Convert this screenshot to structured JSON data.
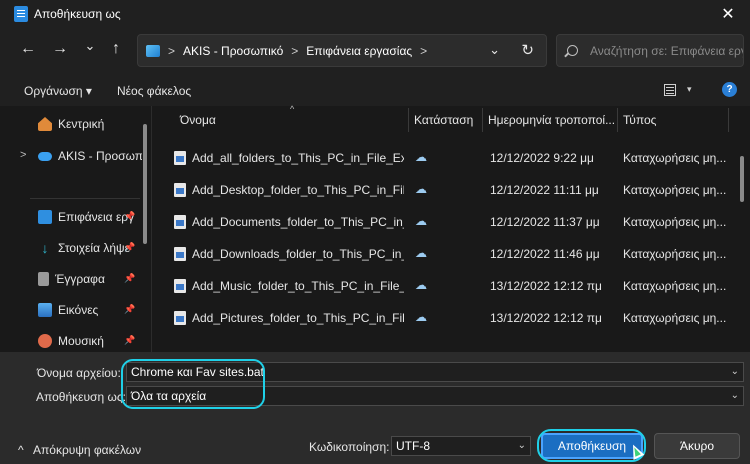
{
  "window": {
    "title": "Αποθήκευση ως",
    "close_glyph": "✕"
  },
  "nav": {
    "back_glyph": "←",
    "forward_glyph": "→",
    "recent_glyph": "⌄",
    "up_glyph": "↑",
    "breadcrumbs": [
      "AKIS - Προσωπικό",
      "Επιφάνεια εργασίας"
    ],
    "crumb_sep": ">",
    "dropdown_glyph": "⌄",
    "refresh_glyph": "↻",
    "search_placeholder": "Αναζήτηση σε: Επιφάνεια εργ"
  },
  "toolbar": {
    "organize_label": "Οργάνωση ▾",
    "new_folder_label": "Νέος φάκελος",
    "view_dd_glyph": "▾",
    "help_glyph": "?"
  },
  "sidebar": {
    "home_label": "Κεντρική",
    "cloud_label": "AKIS - Προσωπικό",
    "chevron_glyph": ">",
    "pin_glyph": "📌",
    "quick": [
      {
        "label": "Επιφάνεια εργ",
        "icon": "desktop-icon",
        "color": "#2f8fe0"
      },
      {
        "label": "Στοιχεία λήψε",
        "icon": "download-icon",
        "color": "#2fb2c8"
      },
      {
        "label": "Έγγραφα",
        "icon": "documents-icon",
        "color": "#9a9a9a"
      },
      {
        "label": "Εικόνες",
        "icon": "pictures-icon",
        "color": "#3a8fd8"
      },
      {
        "label": "Μουσική",
        "icon": "music-icon",
        "color": "#e06a4a"
      }
    ]
  },
  "columns": {
    "name": "Όνομα",
    "status": "Κατάσταση",
    "date": "Ημερομηνία τροποποί...",
    "type": "Τύπος",
    "sort_glyph": "^"
  },
  "files": [
    {
      "name": "Add_all_folders_to_This_PC_in_File_Explor...",
      "status_glyph": "☁",
      "date": "12/12/2022 9:22 μμ",
      "type": "Καταχωρήσεις μη..."
    },
    {
      "name": "Add_Desktop_folder_to_This_PC_in_File_E...",
      "status_glyph": "☁",
      "date": "12/12/2022 11:11 μμ",
      "type": "Καταχωρήσεις μη..."
    },
    {
      "name": "Add_Documents_folder_to_This_PC_in_Fil...",
      "status_glyph": "☁",
      "date": "12/12/2022 11:37 μμ",
      "type": "Καταχωρήσεις μη..."
    },
    {
      "name": "Add_Downloads_folder_to_This_PC_in_Fil...",
      "status_glyph": "☁",
      "date": "12/12/2022 11:46 μμ",
      "type": "Καταχωρήσεις μη..."
    },
    {
      "name": "Add_Music_folder_to_This_PC_in_File_Exp...",
      "status_glyph": "☁",
      "date": "13/12/2022 12:12 πμ",
      "type": "Καταχωρήσεις μη..."
    },
    {
      "name": "Add_Pictures_folder_to_This_PC_in_File_E...",
      "status_glyph": "☁",
      "date": "13/12/2022 12:12 πμ",
      "type": "Καταχωρήσεις μη..."
    }
  ],
  "form": {
    "filename_label": "Όνομα αρχείου:",
    "filename_value": "Chrome και Fav sites.bat",
    "savetype_label": "Αποθήκευση ως:",
    "savetype_value": "Όλα τα αρχεία",
    "dd_glyph": "⌄",
    "hide_folders_label": "Απόκρυψη φακέλων",
    "hide_glyph": "^",
    "encoding_label": "Κωδικοποίηση:",
    "encoding_value": "UTF-8",
    "save_label": "Αποθήκευση",
    "cancel_label": "Άκυρο"
  },
  "colors": {
    "highlight": "#1fd0e8",
    "save_button": "#1b6ec2",
    "cancel_button": "#3a3a3a",
    "folder_accent": "#2b8be0"
  }
}
